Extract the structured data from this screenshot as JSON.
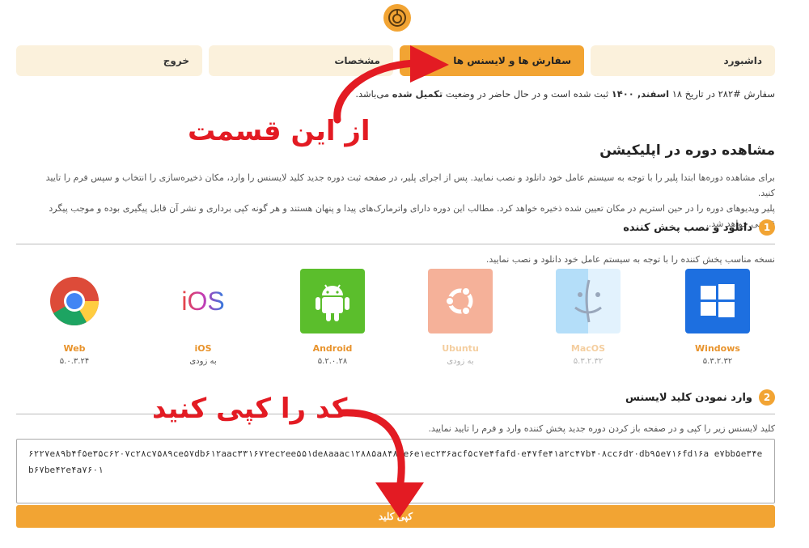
{
  "header": {
    "logo_icon": "logo-icon"
  },
  "tabs": [
    {
      "label": "داشبورد"
    },
    {
      "label": "سفارش ها و لایسنس ها"
    },
    {
      "label": "مشخصات"
    },
    {
      "label": "خروج"
    }
  ],
  "order_status": {
    "text_prefix": "سفارش #۲۸۲ در تاریخ ۱۸ ",
    "date_bold": "اسفند, ۱۴۰۰",
    "text_middle": " ثبت شده است و در حال حاضر در وضعیت ",
    "status_bold": "تکمیل شده",
    "text_suffix": " می‌باشد."
  },
  "section": {
    "title": "مشاهده دوره در اپلیکیشن",
    "desc1": "برای مشاهده دوره‌ها ابتدا پلیر را با توجه به سیستم عامل خود دانلود و نصب نمایید. پس از اجرای پلیر، در صفحه ثبت دوره جدید کلید لایسنس را وارد، مکان ذخیره‌سازی را انتخاب و سپس فرم را تایید کنید.",
    "desc2": "پلیر ویدیوهای دوره را در حین استریم در مکان تعیین شده ذخیره خواهد کرد. مطالب این دوره دارای واترمارک‌های پیدا و پنهان هستند و هر گونه کپی برداری و نشر آن قابل پیگیری بوده و موجب پیگرد قانونی خواهد شد."
  },
  "step1": {
    "number": "1",
    "title": "دانلود و نصب پخش کننده",
    "hint": "نسخه مناسب پخش کننده را با توجه به سیستم عامل خود دانلود و نصب نمایید."
  },
  "platforms": [
    {
      "name": "Windows",
      "version": "۵.۳.۲.۳۲",
      "icon": "windows-icon",
      "available": true
    },
    {
      "name": "MacOS",
      "version": "۵.۳.۲.۳۲",
      "icon": "finder-icon",
      "available": false
    },
    {
      "name": "Ubuntu",
      "version": "به زودی",
      "icon": "ubuntu-icon",
      "available": false
    },
    {
      "name": "Android",
      "version": "۵.۲.۰.۲۸",
      "icon": "android-icon",
      "available": true
    },
    {
      "name": "iOS",
      "version": "به زودی",
      "icon": "ios-icon",
      "available": true
    },
    {
      "name": "Web",
      "version": "۵.۰.۳.۲۴",
      "icon": "chrome-icon",
      "available": true
    }
  ],
  "step2": {
    "number": "2",
    "title": "وارد نمودن کلید لایسنس",
    "hint": "کلید لایسنس زیر را کپی و در صفحه باز کردن دوره جدید پخش کننده وارد و فرم را تایید نمایید.",
    "license_key": "۶۲۲۷e۸۹b۴f۵e۳۵c۶۲۰۷c۲۸c۷۵۸۹ce۵۷db۶۱۲aac۳۳۱۶۷۲ec۲ee۵۵۱de۸aaac۱۲۸۸۵a۸۴۸۶e۶e۱ec۲۳۶acf۵c۷e۴fafd۰e۴۷fe۴۱a۲c۴۷b۴۰۸cc۶d۲۰db۹۵e۷۱۶fd۱۶a e۷bb۵e۳۴eb۶۷be۴۲e۴a۷۶۰۱",
    "copy_label": "کپی کلید"
  },
  "annotations": {
    "from_here": "از این قسمت",
    "copy_code": "کد را کپی کنید"
  },
  "colors": {
    "accent": "#f2a433",
    "accent_light": "#fbf1dc",
    "annotation": "#e31b23"
  }
}
